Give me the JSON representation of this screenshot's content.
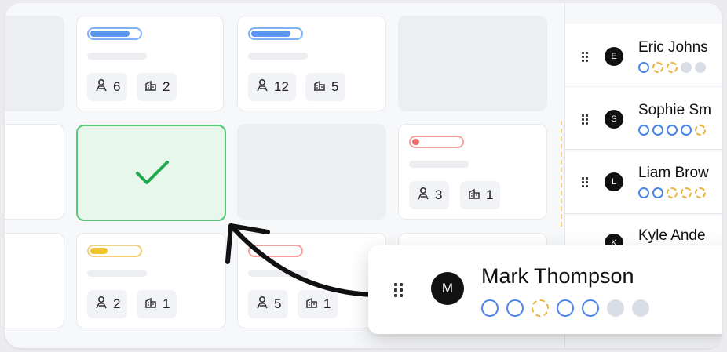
{
  "cards": [
    {
      "bar_color": "#5b97f0",
      "bar_border": "#7fb1f5",
      "bar_fill_fraction": 0.8,
      "people": "6",
      "rooms": "2"
    },
    {
      "bar_color": "#5b97f0",
      "bar_border": "#7fb1f5",
      "bar_fill_fraction": 0.8,
      "people": "12",
      "rooms": "5"
    },
    {
      "bar_color": "#ec6a6a",
      "bar_border": "#f3a0a0",
      "bar_fill_fraction": 0.15,
      "people": "3",
      "rooms": "1"
    },
    {
      "bar_color": "#f2c32e",
      "bar_border": "#f1d27a",
      "bar_fill_fraction": 0.35,
      "people": "2",
      "rooms": "1"
    },
    {
      "bar_color": "#ec6a6a",
      "bar_border": "#f3a0a0",
      "bar_fill_fraction": 0.0,
      "people": "5",
      "rooms": "1"
    }
  ],
  "icons": {
    "people": "person-icon",
    "rooms": "room-icon",
    "check": "checkmark-icon",
    "grip": "drag-handle-icon",
    "arrow": "curved-arrow-icon"
  },
  "people_list": [
    {
      "initial": "E",
      "name": "Eric Johns",
      "dots": [
        "o",
        "y",
        "y",
        "g",
        "g"
      ]
    },
    {
      "initial": "S",
      "name": "Sophie Sm",
      "dots": [
        "o",
        "o",
        "o",
        "o",
        "y"
      ]
    },
    {
      "initial": "L",
      "name": "Liam Brow",
      "dots": [
        "o",
        "o",
        "y",
        "y",
        "y"
      ]
    },
    {
      "initial": "K",
      "name": "Kyle Ande",
      "dots": []
    }
  ],
  "drag_card": {
    "initial": "M",
    "name": "Mark Thompson",
    "dots": [
      "o",
      "o",
      "y",
      "o",
      "o",
      "g",
      "g"
    ]
  },
  "colors": {
    "success_border": "#55c979",
    "success_bg": "#e8f7ec",
    "check": "#22a84c",
    "ring_blue": "#4a84e8",
    "ring_yellow": "#e9b43a"
  }
}
